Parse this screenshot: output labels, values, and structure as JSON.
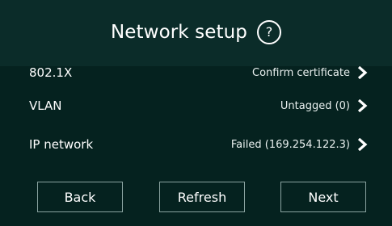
{
  "header": {
    "title": "Network setup",
    "help_icon_glyph": "?"
  },
  "settings": [
    {
      "label": "802.1X",
      "value": "Confirm certificate",
      "icon": "chevron-right-icon"
    },
    {
      "label": "VLAN",
      "value": "Untagged (0)",
      "icon": "chevron-right-icon"
    },
    {
      "label": "IP network",
      "value": "Failed (169.254.122.3)",
      "icon": "chevron-right-icon"
    }
  ],
  "footer": {
    "back_label": "Back",
    "refresh_label": "Refresh",
    "next_label": "Next"
  },
  "colors": {
    "background": "#05221f",
    "header_background": "#0b2c29",
    "text": "#ffffff",
    "button_border": "#8aa3a0"
  }
}
